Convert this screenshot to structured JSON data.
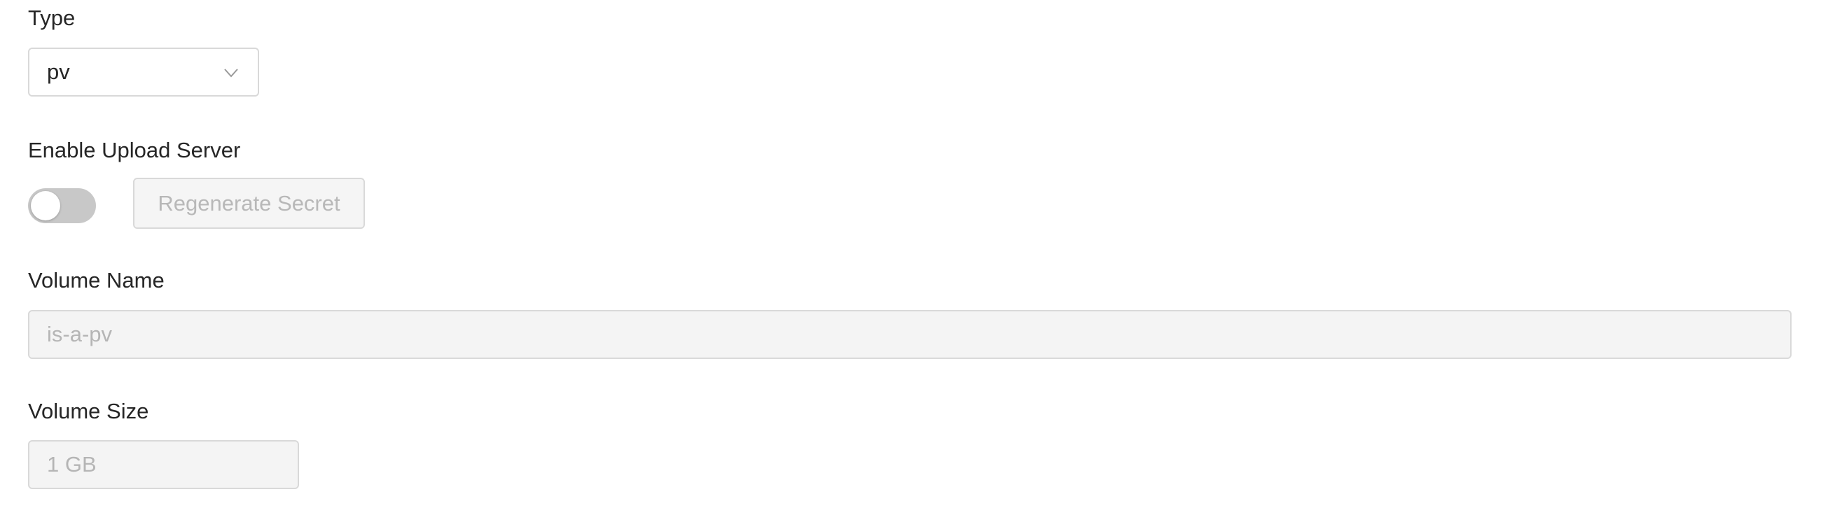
{
  "type_field": {
    "label": "Type",
    "selected": "pv",
    "chevron_icon": "chevron-down-icon"
  },
  "upload_server": {
    "label": "Enable Upload Server",
    "toggle_on": false,
    "regenerate_button_label": "Regenerate Secret",
    "regenerate_disabled": true
  },
  "volume_name": {
    "label": "Volume Name",
    "placeholder": "is-a-pv",
    "disabled": true
  },
  "volume_size": {
    "label": "Volume Size",
    "placeholder": "1 GB",
    "disabled": true
  },
  "colors": {
    "text": "#262626",
    "border": "#d9d9d9",
    "disabled_bg": "#f4f4f4",
    "disabled_text": "#b5b5b5",
    "toggle_off": "#c8c8c8"
  }
}
